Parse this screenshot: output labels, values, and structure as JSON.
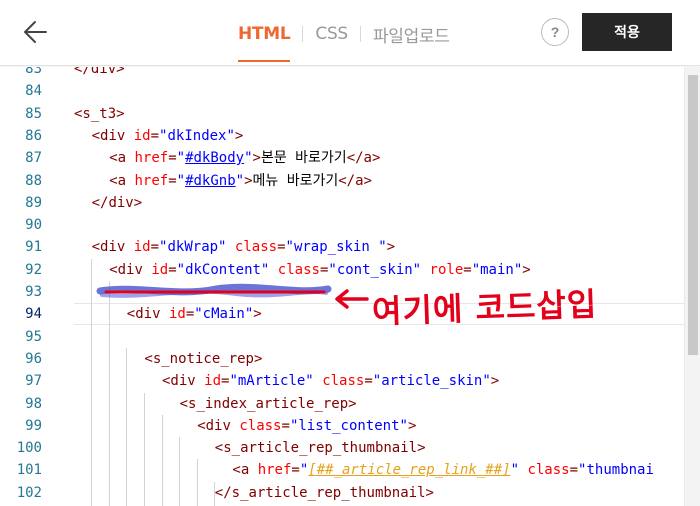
{
  "header": {
    "tabs": [
      {
        "label": "HTML",
        "active": true
      },
      {
        "label": "CSS",
        "active": false
      },
      {
        "label": "파일업로드",
        "active": false
      }
    ],
    "help_label": "?",
    "apply_label": "적용"
  },
  "editor": {
    "lines": [
      {
        "n": "83",
        "indent": 0,
        "html": "<span class=\"tag\">&lt;/div&gt;</span>"
      },
      {
        "n": "84",
        "indent": 0,
        "html": ""
      },
      {
        "n": "85",
        "indent": 0,
        "html": "<span class=\"tag\">&lt;s_t3&gt;</span>"
      },
      {
        "n": "86",
        "indent": 1,
        "html": "<span class=\"tag\">&lt;div</span> <span class=\"attr\">id</span>=<span class=\"val\">\"dkIndex\"</span><span class=\"tag\">&gt;</span>"
      },
      {
        "n": "87",
        "indent": 2,
        "html": "<span class=\"tag\">&lt;a</span> <span class=\"attr\">href</span>=<span class=\"val\">\"<span class=\"link\">#dkBody</span>\"</span><span class=\"tag\">&gt;</span><span class=\"txt\">본문 바로가기</span><span class=\"tag\">&lt;/a&gt;</span>"
      },
      {
        "n": "88",
        "indent": 2,
        "html": "<span class=\"tag\">&lt;a</span> <span class=\"attr\">href</span>=<span class=\"val\">\"<span class=\"link\">#dkGnb</span>\"</span><span class=\"tag\">&gt;</span><span class=\"txt\">메뉴 바로가기</span><span class=\"tag\">&lt;/a&gt;</span>"
      },
      {
        "n": "89",
        "indent": 1,
        "html": "<span class=\"tag\">&lt;/div&gt;</span>"
      },
      {
        "n": "90",
        "indent": 0,
        "html": ""
      },
      {
        "n": "91",
        "indent": 1,
        "html": "<span class=\"tag\">&lt;div</span> <span class=\"attr\">id</span>=<span class=\"val\">\"dkWrap\"</span> <span class=\"attr\">class</span>=<span class=\"val\">\"wrap_skin \"</span><span class=\"tag\">&gt;</span>"
      },
      {
        "n": "92",
        "indent": 2,
        "html": "<span class=\"tag\">&lt;div</span> <span class=\"attr\">id</span>=<span class=\"val\">\"dkContent\"</span> <span class=\"attr\">class</span>=<span class=\"val\">\"cont_skin\"</span> <span class=\"attr\">role</span>=<span class=\"val\">\"main\"</span><span class=\"tag\">&gt;</span>"
      },
      {
        "n": "93",
        "indent": 0,
        "html": ""
      },
      {
        "n": "94",
        "indent": 3,
        "html": "<span class=\"tag\">&lt;div</span> <span class=\"attr\">id</span>=<span class=\"val\">\"cMain\"</span><span class=\"tag\">&gt;</span>",
        "current": true
      },
      {
        "n": "95",
        "indent": 0,
        "html": ""
      },
      {
        "n": "96",
        "indent": 4,
        "html": "<span class=\"tag\">&lt;s_notice_rep&gt;</span>"
      },
      {
        "n": "97",
        "indent": 5,
        "html": "<span class=\"tag\">&lt;div</span> <span class=\"attr\">id</span>=<span class=\"val\">\"mArticle\"</span> <span class=\"attr\">class</span>=<span class=\"val\">\"article_skin\"</span><span class=\"tag\">&gt;</span>"
      },
      {
        "n": "98",
        "indent": 6,
        "html": "<span class=\"tag\">&lt;s_index_article_rep&gt;</span>"
      },
      {
        "n": "99",
        "indent": 7,
        "html": "<span class=\"tag\">&lt;div</span> <span class=\"attr\">class</span>=<span class=\"val\">\"list_content\"</span><span class=\"tag\">&gt;</span>"
      },
      {
        "n": "100",
        "indent": 8,
        "html": "<span class=\"tag\">&lt;s_article_rep_thumbnail&gt;</span>"
      },
      {
        "n": "101",
        "indent": 9,
        "html": "<span class=\"tag\">&lt;a</span> <span class=\"attr\">href</span>=<span class=\"val\">\"<span class=\"tmpl\">[##_article_rep_link_##]</span>\"</span> <span class=\"attr\">class</span>=<span class=\"val\">\"thumbnai</span>"
      },
      {
        "n": "102",
        "indent": 8,
        "html": "<span class=\"tag\">&lt;/s_article_rep_thumbnail&gt;</span>"
      }
    ]
  },
  "annotation": {
    "text": "여기에 코드삽입",
    "color": "#e3001b"
  }
}
